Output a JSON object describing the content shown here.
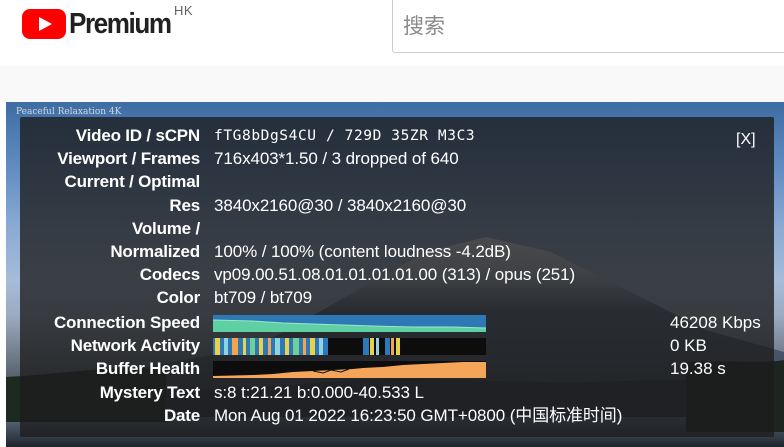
{
  "header": {
    "logo_text": "Premium",
    "country_code": "HK",
    "search_placeholder": "搜索"
  },
  "video": {
    "title": "Peaceful Relaxation 4K"
  },
  "stats": {
    "close_label": "[X]",
    "rows": {
      "video_id": {
        "label": "Video ID / sCPN",
        "value": "fTG8bDgS4CU / 729D 35ZR M3C3"
      },
      "viewport": {
        "label": "Viewport / Frames",
        "value": "716x403*1.50 / 3 dropped of 640"
      },
      "current_optimal": {
        "label": "Current / Optimal",
        "value": ""
      },
      "res": {
        "label": "Res",
        "value": "3840x2160@30 / 3840x2160@30"
      },
      "volume": {
        "label": "Volume /",
        "value": ""
      },
      "normalized": {
        "label": "Normalized",
        "value": "100% / 100% (content loudness -4.2dB)"
      },
      "codecs": {
        "label": "Codecs",
        "value": "vp09.00.51.08.01.01.01.01.00 (313) / opus (251)"
      },
      "color": {
        "label": "Color",
        "value": "bt709 / bt709"
      },
      "connection_speed": {
        "label": "Connection Speed",
        "value": "46208 Kbps"
      },
      "network_activity": {
        "label": "Network Activity",
        "value": "0 KB"
      },
      "buffer_health": {
        "label": "Buffer Health",
        "value": "19.38 s"
      },
      "mystery_text": {
        "label": "Mystery Text",
        "value": "s:8 t:21.21 b:0.000-40.533 L"
      },
      "date": {
        "label": "Date",
        "value": "Mon Aug 01 2022 16:23:50 GMT+0800 (中国标准时间)"
      }
    }
  },
  "colors": {
    "brand_red": "#ff0000",
    "speed_graph": "#2f78b6",
    "speed_fill": "#5fd0a4",
    "network_graph": "#2d79b7",
    "buffer_graph": "#f5a55a"
  }
}
